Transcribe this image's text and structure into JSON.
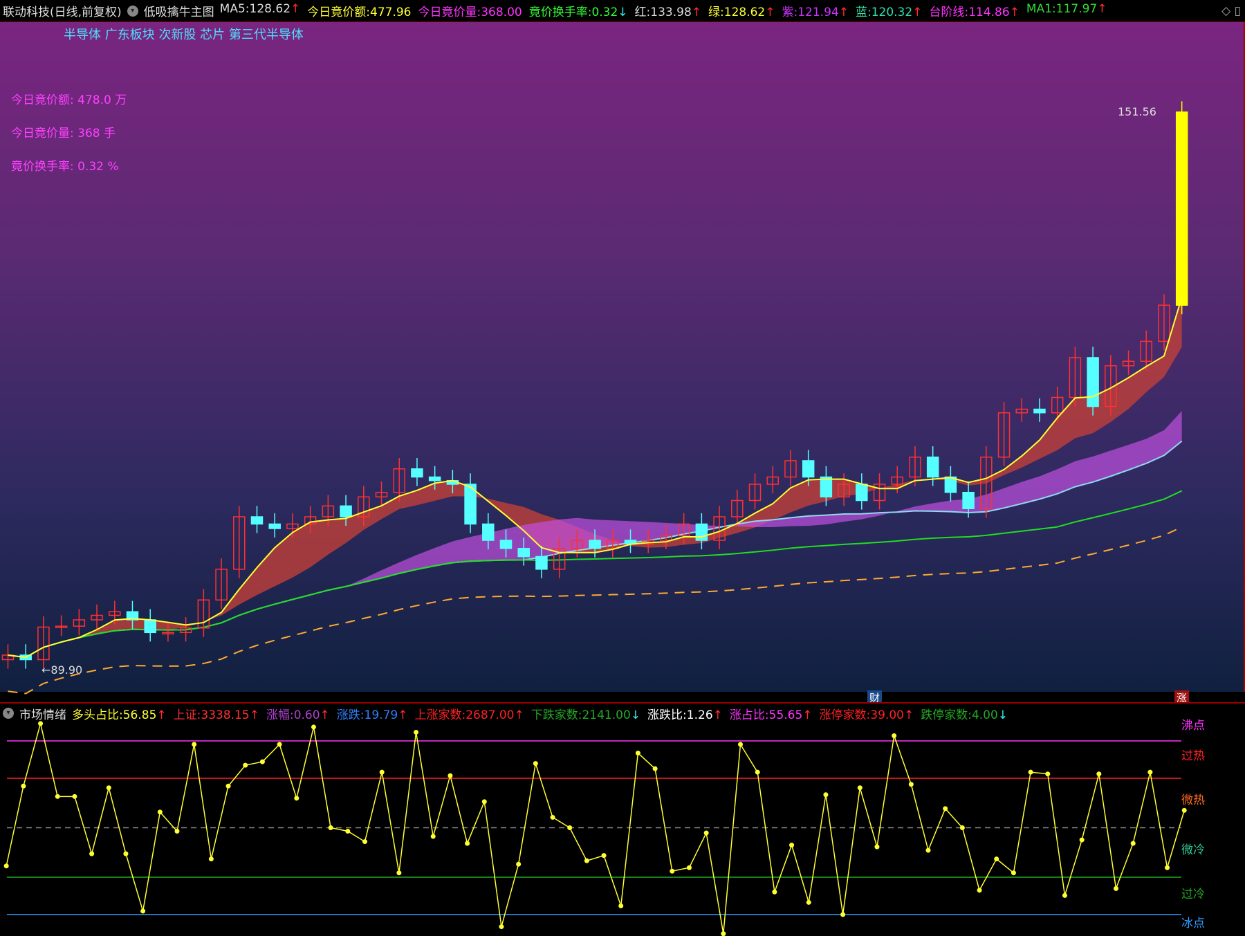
{
  "header": {
    "title": "联动科技(日线,前复权)",
    "indicator": "低吸擒牛主图",
    "items": [
      {
        "label": "MA5",
        "value": "128.62",
        "dir": "up",
        "color": "#dddddd"
      },
      {
        "label": "今日竟价额",
        "value": "477.96",
        "dir": "",
        "color": "#ffff33"
      },
      {
        "label": "今日竟价量",
        "value": "368.00",
        "dir": "",
        "color": "#ff33ff"
      },
      {
        "label": "竟价换手率",
        "value": "0.32",
        "dir": "dn",
        "color": "#33ff33"
      },
      {
        "label": "红",
        "value": "133.98",
        "dir": "up",
        "color": "#dddddd"
      },
      {
        "label": "绿",
        "value": "128.62",
        "dir": "up",
        "color": "#ffff33"
      },
      {
        "label": "紫",
        "value": "121.94",
        "dir": "up",
        "color": "#cc33ff"
      },
      {
        "label": "蓝",
        "value": "120.32",
        "dir": "up",
        "color": "#33ddaa"
      },
      {
        "label": "台阶线",
        "value": "114.86",
        "dir": "up",
        "color": "#ff33ff"
      },
      {
        "label": "MA1",
        "value": "117.97",
        "dir": "up",
        "color": "#33dd33"
      }
    ]
  },
  "tags": "半导体 广东板块 次新股 芯片 第三代半导体",
  "info": [
    "今日竟价额: 478.0 万",
    "今日竟价量: 368 手",
    "竟价换手率: 0.32 %"
  ],
  "price_labels": {
    "high": "151.56",
    "low": "89.90"
  },
  "badges": {
    "cai": "财",
    "zhang": "涨"
  },
  "colors": {
    "up": "#ff3030",
    "down": "#55ffff",
    "ma5": "#ffff33",
    "band": "#c0403a",
    "purple": "#c050e0",
    "blue": "#8fd8f0",
    "green": "#22dd22",
    "step": "#ffaa33"
  },
  "closes": [
    91.5,
    91,
    94.6,
    94.7,
    95.4,
    95.9,
    96.3,
    95.4,
    94,
    94,
    94.5,
    97.6,
    101,
    106.8,
    106,
    105.5,
    106,
    106.8,
    108,
    106.8,
    109,
    109.5,
    112.1,
    111.2,
    110.8,
    110.4,
    106,
    104.2,
    103.3,
    102.4,
    101,
    103.3,
    104.2,
    103.3,
    104.2,
    103.8,
    104.2,
    104.7,
    106,
    104.2,
    106.8,
    108.6,
    110.4,
    111.2,
    113,
    111.2,
    109,
    110.4,
    108.6,
    110.4,
    111.2,
    113.4,
    111.2,
    109.5,
    107.7,
    113.4,
    118.3,
    118.7,
    118.3,
    120,
    124.4,
    119,
    123.5,
    124,
    126.2,
    130.2,
    151.56
  ],
  "sub": {
    "title": "市场情绪",
    "items": [
      {
        "label": "多头占比",
        "value": "56.85",
        "dir": "up",
        "color": "#ffff33"
      },
      {
        "label": "上证",
        "value": "3338.15",
        "dir": "up",
        "color": "#ff3030"
      },
      {
        "label": "涨幅",
        "value": "0.60",
        "dir": "up",
        "color": "#b040d0"
      },
      {
        "label": "涨跌",
        "value": "19.79",
        "dir": "up",
        "color": "#3080ff"
      },
      {
        "label": "上涨家数",
        "value": "2687.00",
        "dir": "up",
        "color": "#ff2020"
      },
      {
        "label": "下跌家数",
        "value": "2141.00",
        "dir": "dn",
        "color": "#22aa22"
      },
      {
        "label": "涨跌比",
        "value": "1.26",
        "dir": "up",
        "color": "#ffffff"
      },
      {
        "label": "涨占比",
        "value": "55.65",
        "dir": "up",
        "color": "#ff33ff"
      },
      {
        "label": "涨停家数",
        "value": "39.00",
        "dir": "up",
        "color": "#ff2020"
      },
      {
        "label": "跌停家数",
        "value": "4.00",
        "dir": "dn",
        "color": "#22aa22"
      }
    ],
    "levels": [
      {
        "name": "沸点",
        "value": 100,
        "color": "#ff33ff"
      },
      {
        "name": "过热",
        "value": 78.5,
        "color": "#ff2020"
      },
      {
        "name": "微热",
        "value": 50,
        "color": "#ff6a20"
      },
      {
        "name": "微冷",
        "value": 21.5,
        "color": "#33cc99"
      },
      {
        "name": "过冷",
        "value": 5,
        "color": "#22aa22"
      },
      {
        "name": "冰点",
        "value": 0,
        "color": "#3399ff"
      }
    ],
    "values": [
      28,
      74,
      110,
      68,
      68,
      35,
      73,
      35,
      2,
      59,
      48,
      98,
      32,
      74,
      86,
      88,
      98,
      67,
      108,
      50,
      48,
      42,
      82,
      24,
      105,
      45,
      80,
      41,
      65,
      -7,
      29,
      87,
      56,
      50,
      31,
      34,
      5,
      93,
      84,
      25,
      27,
      47,
      -11,
      98,
      82,
      13,
      40,
      7,
      69,
      0,
      73,
      39,
      103,
      75,
      37,
      61,
      50,
      14,
      32,
      24,
      82,
      81,
      11,
      43,
      81,
      15,
      41,
      82,
      27,
      60
    ]
  }
}
